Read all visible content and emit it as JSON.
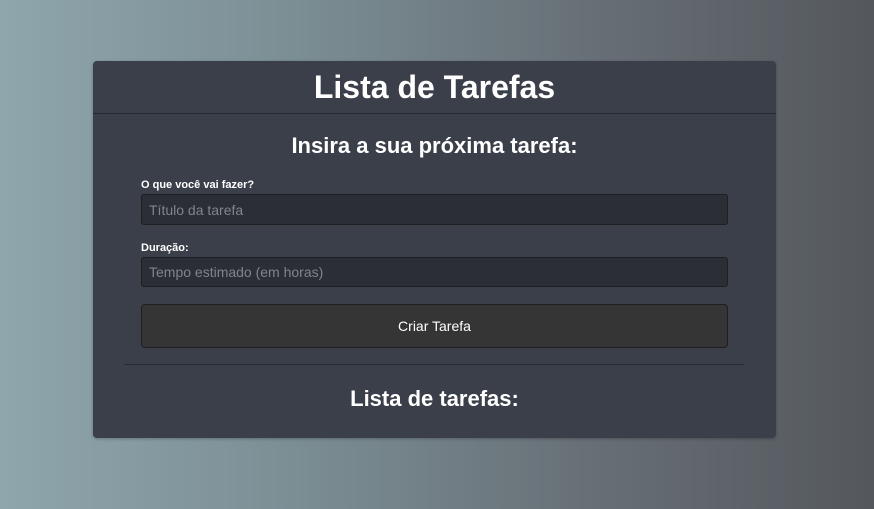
{
  "header": {
    "title": "Lista de Tarefas"
  },
  "form": {
    "heading": "Insira a sua próxima tarefa:",
    "task_label": "O que você vai fazer?",
    "task_placeholder": "Título da tarefa",
    "task_value": "",
    "duration_label": "Duração:",
    "duration_placeholder": "Tempo estimado (em horas)",
    "duration_value": "",
    "submit_label": "Criar Tarefa"
  },
  "list": {
    "heading": "Lista de tarefas:",
    "items": []
  },
  "colors": {
    "card_background": "#3a3f49",
    "input_background": "#2b2e34",
    "button_background": "#353535",
    "text": "#ffffff"
  }
}
